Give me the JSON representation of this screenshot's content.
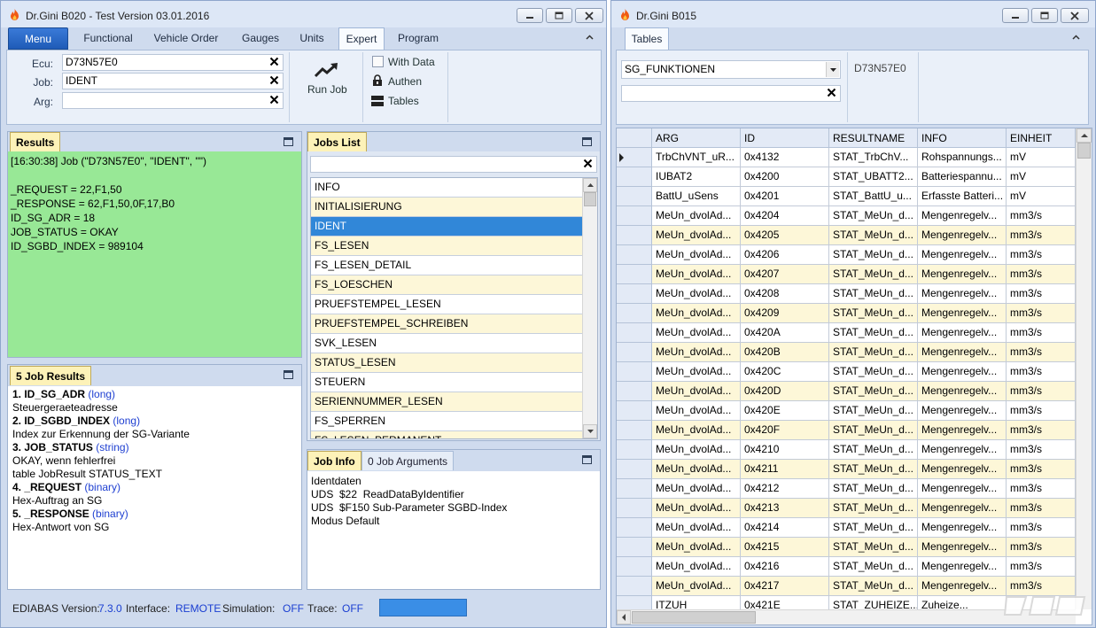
{
  "window1": {
    "title": "Dr.Gini B020 - Test Version 03.01.2016",
    "tabs": [
      "Menu",
      "Functional",
      "Vehicle Order",
      "Gauges",
      "Units",
      "Expert",
      "Program"
    ],
    "active_tab": "Expert",
    "ecu_label": "Ecu:",
    "ecu_value": "D73N57E0",
    "job_label": "Job:",
    "job_value": "IDENT",
    "arg_label": "Arg:",
    "arg_value": "",
    "run_job_label": "Run Job",
    "with_data_label": "With Data",
    "authen_label": "Authen",
    "tables_label": "Tables",
    "results": {
      "tab_label": "Results",
      "lines": [
        "[16:30:38] Job (\"D73N57E0\", \"IDENT\", \"\")",
        "",
        "_REQUEST = 22,F1,50",
        "_RESPONSE = 62,F1,50,0F,17,B0",
        "ID_SG_ADR = 18",
        "JOB_STATUS = OKAY",
        "ID_SGBD_INDEX = 989104"
      ]
    },
    "job_results": {
      "tab_label": "5 Job Results",
      "items": [
        {
          "title": "1. ID_SG_ADR",
          "type": "(long)",
          "desc": [
            "Steuergeraeteadresse"
          ]
        },
        {
          "title": "2. ID_SGBD_INDEX",
          "type": "(long)",
          "desc": [
            "Index zur Erkennung der SG-Variante"
          ]
        },
        {
          "title": "3. JOB_STATUS",
          "type": "(string)",
          "desc": [
            "OKAY, wenn fehlerfrei",
            "table JobResult STATUS_TEXT"
          ]
        },
        {
          "title": "4. _REQUEST",
          "type": "(binary)",
          "desc": [
            "Hex-Auftrag an SG"
          ]
        },
        {
          "title": "5. _RESPONSE",
          "type": "(binary)",
          "desc": [
            "Hex-Antwort von SG"
          ]
        }
      ]
    },
    "jobs_list": {
      "tab_label": "Jobs List",
      "filter_value": "",
      "items": [
        "INFO",
        "INITIALISIERUNG",
        "IDENT",
        "FS_LESEN",
        "FS_LESEN_DETAIL",
        "FS_LOESCHEN",
        "PRUEFSTEMPEL_LESEN",
        "PRUEFSTEMPEL_SCHREIBEN",
        "SVK_LESEN",
        "STATUS_LESEN",
        "STEUERN",
        "SERIENNUMMER_LESEN",
        "FS_SPERREN",
        "FS_LESEN_PERMANENT"
      ],
      "selected": "IDENT"
    },
    "job_info": {
      "tab_label": "Job Info",
      "tab2_label": "0 Job Arguments",
      "lines": [
        "Identdaten",
        "UDS  $22  ReadDataByIdentifier",
        "UDS  $F150 Sub-Parameter SGBD-Index",
        "Modus Default"
      ]
    },
    "status": {
      "ediabas_label": "EDIABAS Version:",
      "ediabas_value": "7.3.0",
      "interface_label": "Interface:",
      "interface_value": "REMOTE",
      "simulation_label": "Simulation:",
      "simulation_value": "OFF",
      "trace_label": "Trace:",
      "trace_value": "OFF"
    }
  },
  "window2": {
    "title": "Dr.Gini B015",
    "tab": "Tables",
    "table_select": "SG_FUNKTIONEN",
    "filter_value": "",
    "ecu_value": "D73N57E0",
    "columns": [
      "ARG",
      "ID",
      "RESULTNAME",
      "INFO",
      "EINHEIT"
    ],
    "rows": [
      [
        "TrbChVNT_uR...",
        "0x4132",
        "STAT_TrbChV...",
        "Rohspannungs...",
        "mV"
      ],
      [
        "IUBAT2",
        "0x4200",
        "STAT_UBATT2...",
        "Batteriespannu...",
        "mV"
      ],
      [
        "BattU_uSens",
        "0x4201",
        "STAT_BattU_u...",
        "Erfasste Batteri...",
        "mV"
      ],
      [
        "MeUn_dvolAd...",
        "0x4204",
        "STAT_MeUn_d...",
        "Mengenregelv...",
        "mm3/s"
      ],
      [
        "MeUn_dvolAd...",
        "0x4205",
        "STAT_MeUn_d...",
        "Mengenregelv...",
        "mm3/s"
      ],
      [
        "MeUn_dvolAd...",
        "0x4206",
        "STAT_MeUn_d...",
        "Mengenregelv...",
        "mm3/s"
      ],
      [
        "MeUn_dvolAd...",
        "0x4207",
        "STAT_MeUn_d...",
        "Mengenregelv...",
        "mm3/s"
      ],
      [
        "MeUn_dvolAd...",
        "0x4208",
        "STAT_MeUn_d...",
        "Mengenregelv...",
        "mm3/s"
      ],
      [
        "MeUn_dvolAd...",
        "0x4209",
        "STAT_MeUn_d...",
        "Mengenregelv...",
        "mm3/s"
      ],
      [
        "MeUn_dvolAd...",
        "0x420A",
        "STAT_MeUn_d...",
        "Mengenregelv...",
        "mm3/s"
      ],
      [
        "MeUn_dvolAd...",
        "0x420B",
        "STAT_MeUn_d...",
        "Mengenregelv...",
        "mm3/s"
      ],
      [
        "MeUn_dvolAd...",
        "0x420C",
        "STAT_MeUn_d...",
        "Mengenregelv...",
        "mm3/s"
      ],
      [
        "MeUn_dvolAd...",
        "0x420D",
        "STAT_MeUn_d...",
        "Mengenregelv...",
        "mm3/s"
      ],
      [
        "MeUn_dvolAd...",
        "0x420E",
        "STAT_MeUn_d...",
        "Mengenregelv...",
        "mm3/s"
      ],
      [
        "MeUn_dvolAd...",
        "0x420F",
        "STAT_MeUn_d...",
        "Mengenregelv...",
        "mm3/s"
      ],
      [
        "MeUn_dvolAd...",
        "0x4210",
        "STAT_MeUn_d...",
        "Mengenregelv...",
        "mm3/s"
      ],
      [
        "MeUn_dvolAd...",
        "0x4211",
        "STAT_MeUn_d...",
        "Mengenregelv...",
        "mm3/s"
      ],
      [
        "MeUn_dvolAd...",
        "0x4212",
        "STAT_MeUn_d...",
        "Mengenregelv...",
        "mm3/s"
      ],
      [
        "MeUn_dvolAd...",
        "0x4213",
        "STAT_MeUn_d...",
        "Mengenregelv...",
        "mm3/s"
      ],
      [
        "MeUn_dvolAd...",
        "0x4214",
        "STAT_MeUn_d...",
        "Mengenregelv...",
        "mm3/s"
      ],
      [
        "MeUn_dvolAd...",
        "0x4215",
        "STAT_MeUn_d...",
        "Mengenregelv...",
        "mm3/s"
      ],
      [
        "MeUn_dvolAd...",
        "0x4216",
        "STAT_MeUn_d...",
        "Mengenregelv...",
        "mm3/s"
      ],
      [
        "MeUn_dvolAd...",
        "0x4217",
        "STAT_MeUn_d...",
        "Mengenregelv...",
        "mm3/s"
      ],
      [
        "ITZUH",
        "0x421E",
        "STAT_ZUHEIZE...",
        "Zuheize...",
        ""
      ]
    ]
  },
  "colors": {
    "results_bg": "#98e896",
    "selection": "#3187d8",
    "menu_tab": "#2a6ccc",
    "value_blue": "#1a3ed1",
    "row_alt": "#fdf7d8"
  },
  "icons": [
    "flame-icon",
    "minimize-icon",
    "maximize-icon",
    "close-icon",
    "chevron-up-icon",
    "clear-icon",
    "trend-up-icon",
    "checkbox-icon",
    "lock-icon",
    "table-icon",
    "panel-maximize-icon",
    "dropdown-arrow-icon",
    "row-pointer-icon",
    "scroll-up-icon",
    "scroll-down-icon",
    "scroll-left-icon"
  ]
}
